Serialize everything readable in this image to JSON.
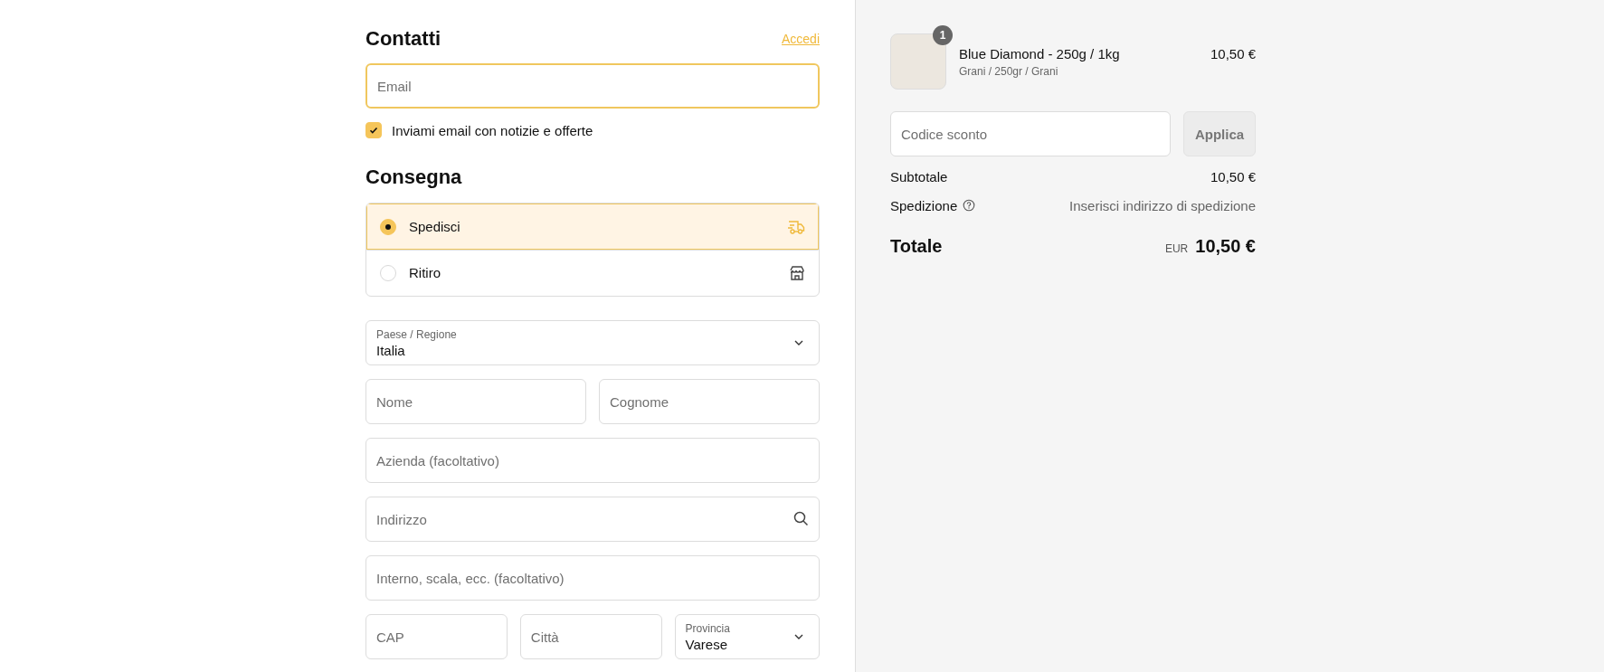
{
  "contact": {
    "title": "Contatti",
    "login_link": "Accedi",
    "email": {
      "placeholder": "Email",
      "focused": true
    },
    "newsletter": {
      "label": "Inviami email con notizie e offerte",
      "checked": true
    }
  },
  "delivery": {
    "title": "Consegna",
    "options": [
      {
        "label": "Spedisci",
        "kind": "ship",
        "selected": true
      },
      {
        "label": "Ritiro",
        "kind": "pickup",
        "selected": false
      }
    ],
    "fields": [
      [
        {
          "kind": "select",
          "label": "Paese / Regione",
          "value": "Italia"
        }
      ],
      [
        {
          "kind": "text",
          "placeholder": "Nome"
        },
        {
          "kind": "text",
          "placeholder": "Cognome"
        }
      ],
      [
        {
          "kind": "text",
          "placeholder": "Azienda (facoltativo)"
        }
      ],
      [
        {
          "kind": "search",
          "placeholder": "Indirizzo"
        }
      ],
      [
        {
          "kind": "text",
          "placeholder": "Interno, scala, ecc. (facoltativo)"
        }
      ],
      [
        {
          "kind": "text",
          "placeholder": "CAP"
        },
        {
          "kind": "text",
          "placeholder": "Città"
        },
        {
          "kind": "select",
          "label": "Provincia",
          "value": "Varese"
        }
      ]
    ]
  },
  "summary": {
    "product": {
      "quantity": "1",
      "name": "Blue Diamond - 250g / 1kg",
      "variant": "Grani / 250gr / Grani",
      "price": "10,50 €"
    },
    "discount": {
      "placeholder": "Codice sconto",
      "button": "Applica"
    },
    "rows": [
      {
        "label": "Subtotale",
        "value": "10,50 €",
        "help": false
      },
      {
        "label": "Spedizione",
        "value": "Inserisci indirizzo di spedizione",
        "help": true
      }
    ],
    "total": {
      "label": "Totale",
      "currency": "EUR",
      "value": "10,50 €"
    }
  }
}
